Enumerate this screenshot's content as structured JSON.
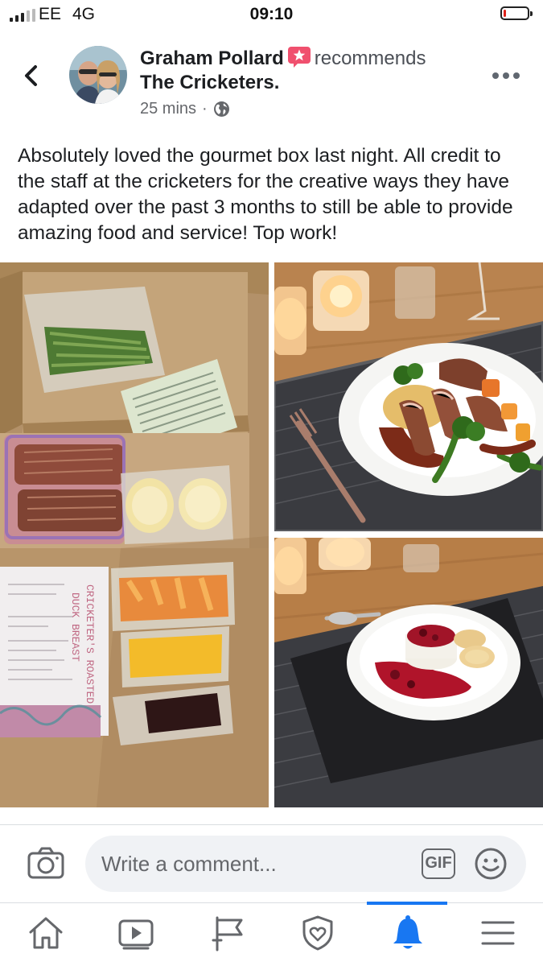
{
  "status_bar": {
    "carrier": "EE",
    "network": "4G",
    "time": "09:10",
    "battery_level": 0.1,
    "battery_color": "#e0231b"
  },
  "post": {
    "author": "Graham Pollard",
    "action": "recommends",
    "page": "The Cricketers.",
    "time_ago": "25 mins",
    "separator": "·",
    "audience_icon": "globe-icon",
    "recommend_icon": "recommend-star-icon",
    "text": "Absolutely loved the gourmet box last night. All credit to the staff at the cricketers for the creative ways they have adapted over the past 3 months to still be able to provide amazing food and service! Top work!",
    "menu_card_text": "CRICKETER'S ROASTED DUCK BREAST"
  },
  "comment_bar": {
    "placeholder": "Write a comment...",
    "gif_label": "GIF",
    "camera_icon": "camera-icon",
    "emoji_icon": "smiley-icon"
  },
  "tab_bar": {
    "tabs": [
      "home-icon",
      "video-icon",
      "pages-flag-icon",
      "dating-shield-icon",
      "notifications-bell-icon",
      "menu-icon"
    ],
    "active_tab": "notifications-bell-icon",
    "accent_color": "#1877f2",
    "icon_color": "#65676b"
  }
}
